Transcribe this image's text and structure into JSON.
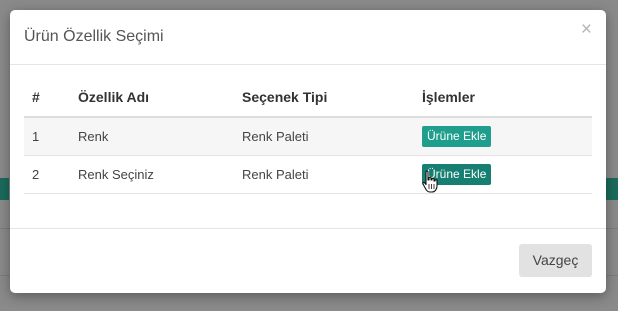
{
  "modal": {
    "title": "Ürün Özellik Seçimi",
    "close_label": "×",
    "cancel_label": "Vazgeç"
  },
  "table": {
    "headers": [
      "#",
      "Özellik Adı",
      "Seçenek Tipi",
      "İşlemler"
    ],
    "rows": [
      {
        "no": "1",
        "name": "Renk",
        "type": "Renk Paleti",
        "action": "Ürüne Ekle"
      },
      {
        "no": "2",
        "name": "Renk Seçiniz",
        "type": "Renk Paleti",
        "action": "Ürüne Ekle"
      }
    ]
  },
  "colors": {
    "button_teal": "#1f9e8d",
    "button_teal_hover": "#177f71",
    "overlay": "#8a8a8a"
  }
}
